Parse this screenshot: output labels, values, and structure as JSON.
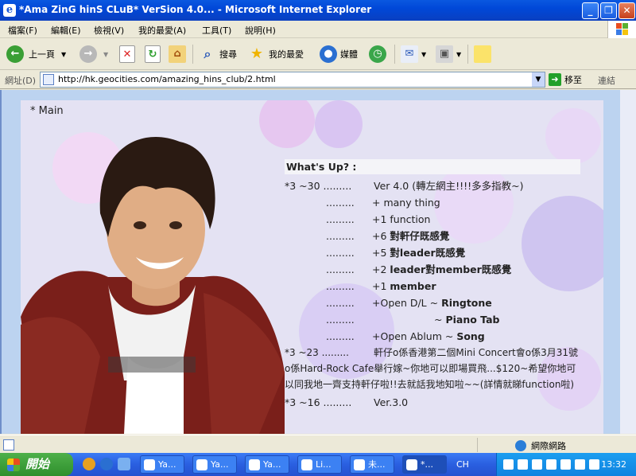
{
  "window": {
    "title": "*Ama ZinG  hinS  CLuB*  VerSion  4.0... - Microsoft Internet Explorer"
  },
  "menu": [
    "檔案(F)",
    "編輯(E)",
    "檢視(V)",
    "我的最愛(A)",
    "工具(T)",
    "說明(H)"
  ],
  "toolbar": {
    "back": "上一頁",
    "search": "搜尋",
    "favorites": "我的最愛",
    "media": "媒體"
  },
  "address": {
    "label": "網址(D)",
    "url": "http://hk.geocities.com/amazing_hins_club/2.html",
    "go": "移至",
    "links": "連結"
  },
  "page": {
    "main_link": "* Main",
    "heading": "What's Up? :",
    "rows": [
      {
        "date": "*3 ~30 .........",
        "text": "Ver 4.0 (轉左網主!!!!多多指教~)",
        "bold": ""
      },
      {
        "date": ".........",
        "text": "+ many thing",
        "bold": ""
      },
      {
        "date": ".........",
        "text": "+1 function",
        "bold": ""
      },
      {
        "date": ".........",
        "text": "+6 ",
        "bold": "對軒仔既感覺"
      },
      {
        "date": ".........",
        "text": "+5 ",
        "bold": "對leader既感覺"
      },
      {
        "date": ".........",
        "text": "+2 ",
        "bold": "leader對member既感覺"
      },
      {
        "date": ".........",
        "text": "+1 ",
        "bold": "member"
      },
      {
        "date": ".........",
        "text": "+Open D/L ~ ",
        "bold": "Ringtone"
      },
      {
        "date": ".........",
        "text": "~ ",
        "bold": "Piano Tab"
      },
      {
        "date": ".........",
        "text": "+Open Ablum ~ ",
        "bold": "Song"
      }
    ],
    "para_date": "*3 ~23 .........",
    "para_text": "軒仔o係香港第二個Mini Concert會o係3月31號o係Hard-Rock Cafe舉行嫁~你地可以即場買飛...$120~希望你地可以同我地一齊支持軒仔啦!!去就話我地知啦~~(詳情就睇function啦)",
    "last_date": "*3 ~16 .........",
    "last_text": "Ver.3.0"
  },
  "status": {
    "zone": "網際網路"
  },
  "taskbar": {
    "start": "開始",
    "tasks": [
      "Ya...",
      "Ya...",
      "Ya...",
      "Li...",
      "未...",
      "*..."
    ],
    "lang": "CH",
    "clock": "13:32"
  },
  "colors": {
    "title_blue": "#0048d8",
    "page_bg": "#e4e2f3",
    "taskbar": "#2a5fe0",
    "start_green": "#3a9f35"
  }
}
